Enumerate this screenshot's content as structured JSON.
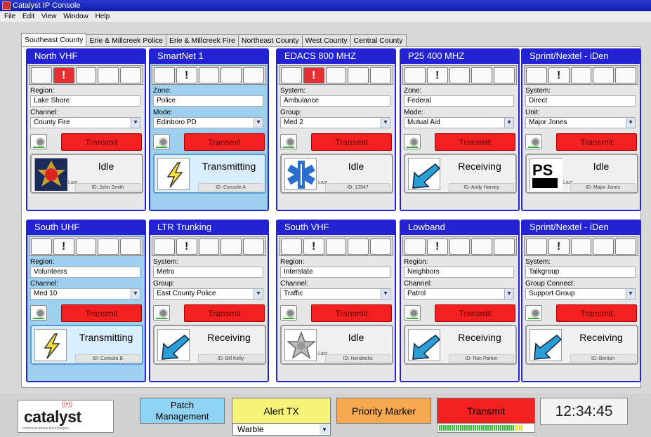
{
  "window": {
    "title": "Catalyst IP Console"
  },
  "menu": [
    "File",
    "Edit",
    "View",
    "Window",
    "Help"
  ],
  "tabs": [
    "Southeast County",
    "Erie & Millcreek Police",
    "Erie & Millcreek Fire",
    "Northeast County",
    "West County",
    "Central County"
  ],
  "transmit_label": "Transmit",
  "cards": [
    {
      "title": "North VHF",
      "f1": "Region:",
      "v1": "Lake Shore",
      "f2": "Channel:",
      "v2": "County Fire",
      "status": "Idle",
      "id": "ID: John Smith",
      "last": "Last",
      "icon": "fire-badge-icon"
    },
    {
      "title": "SmartNet 1",
      "f1": "Zone:",
      "v1": "Police",
      "f2": "Mode:",
      "v2": "Edinboro PD",
      "status": "Transmitting",
      "id": "ID: Console A",
      "icon": "lightning-icon"
    },
    {
      "title": "EDACS 800 MHZ",
      "f1": "System:",
      "v1": "Ambulance",
      "f2": "Group:",
      "v2": "Med 2",
      "status": "Idle",
      "id": "ID: 13947",
      "last": "Last",
      "icon": "star-of-life-icon"
    },
    {
      "title": "P25 400 MHZ",
      "f1": "Zone:",
      "v1": "Federal",
      "f2": "Mode:",
      "v2": "Mutual Aid",
      "status": "Receiving",
      "id": "ID: Andy Harvey",
      "icon": "receive-arrow-icon"
    },
    {
      "title": "Sprint/Nextel - iDen",
      "f1": "System:",
      "v1": "Direct",
      "f2": "Unit:",
      "v2": "Major Jones",
      "status": "Idle",
      "id": "ID: Major Jones",
      "last": "Last",
      "icon": "public-safety-logo"
    },
    {
      "title": "South UHF",
      "f1": "Region:",
      "v1": "Volunteers",
      "f2": "Channel:",
      "v2": "Med 10",
      "status": "Transmitting",
      "id": "ID: Console B",
      "icon": "lightning-icon"
    },
    {
      "title": "LTR Trunking",
      "f1": "System:",
      "v1": "Metro",
      "f2": "Group:",
      "v2": "East County Police",
      "status": "Receiving",
      "id": "ID: Bill Kelly",
      "icon": "receive-arrow-icon"
    },
    {
      "title": "South VHF",
      "f1": "Region:",
      "v1": "Interstate",
      "f2": "Channel:",
      "v2": "Traffic",
      "status": "Idle",
      "id": "ID: Hendricks",
      "last": "Last",
      "icon": "police-star-icon"
    },
    {
      "title": "Lowband",
      "f1": "Region:",
      "v1": "Neighbors",
      "f2": "Channel:",
      "v2": "Patrol",
      "status": "Receiving",
      "id": "ID: Ron Parker",
      "icon": "receive-arrow-icon"
    },
    {
      "title": "Sprint/Nextel - iDen",
      "f1": "System:",
      "v1": "Talkgroup",
      "f2": "Group Connect:",
      "v2": "Support Group",
      "status": "Receiving",
      "id": "ID: Benton",
      "icon": "receive-arrow-icon"
    }
  ],
  "bottom": {
    "logo": "catalyst",
    "logo_tag": "communications technologies",
    "patch": "Patch Management",
    "alert": "Alert TX",
    "alert_tone": "Warble",
    "priority": "Priority Marker",
    "transmit": "Transmit",
    "clock": "12:34:45"
  },
  "colors": {
    "header": "#2323d4",
    "transmit": "#f22020",
    "transmitting_bg": "#9fd0f0"
  }
}
